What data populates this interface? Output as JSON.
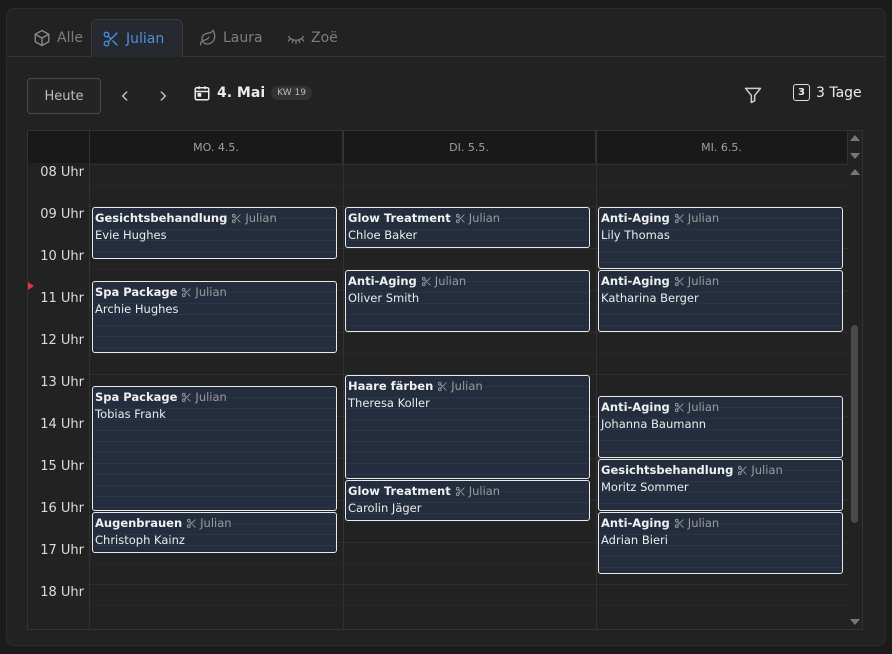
{
  "tabs": [
    {
      "label": "Alle",
      "icon": "cube-icon"
    },
    {
      "label": "Julian",
      "icon": "scissors-icon"
    },
    {
      "label": "Laura",
      "icon": "leaf-icon"
    },
    {
      "label": "Zoë",
      "icon": "eyelash-icon"
    }
  ],
  "active_tab": "Julian",
  "accent_color": "#4b8fe0",
  "toolbar": {
    "today_label": "Heute",
    "date_label": "4. Mai",
    "week_badge": "KW 19",
    "view_count": "3",
    "view_label": "3 Tage"
  },
  "calendar": {
    "days": [
      "MO. 4.5.",
      "DI. 5.5.",
      "MI. 6.5."
    ],
    "hours": [
      "08 Uhr",
      "09 Uhr",
      "10 Uhr",
      "11 Uhr",
      "12 Uhr",
      "13 Uhr",
      "14 Uhr",
      "15 Uhr",
      "16 Uhr",
      "17 Uhr",
      "18 Uhr"
    ],
    "events": [
      {
        "day": 0,
        "start": "09:00",
        "end": "10:15",
        "service": "Gesichtsbehandlung",
        "staff": "Julian",
        "client": "Evie Hughes"
      },
      {
        "day": 0,
        "start": "10:45",
        "end": "12:30",
        "service": "Spa Package",
        "staff": "Julian",
        "client": "Archie Hughes"
      },
      {
        "day": 0,
        "start": "13:15",
        "end": "16:15",
        "service": "Spa Package",
        "staff": "Julian",
        "client": "Tobias Frank"
      },
      {
        "day": 0,
        "start": "16:15",
        "end": "17:15",
        "service": "Augenbrauen",
        "staff": "Julian",
        "client": "Christoph Kainz"
      },
      {
        "day": 1,
        "start": "09:00",
        "end": "10:00",
        "service": "Glow Treatment",
        "staff": "Julian",
        "client": "Chloe Baker"
      },
      {
        "day": 1,
        "start": "10:30",
        "end": "12:00",
        "service": "Anti-Aging",
        "staff": "Julian",
        "client": "Oliver Smith"
      },
      {
        "day": 1,
        "start": "13:00",
        "end": "15:30",
        "service": "Haare färben",
        "staff": "Julian",
        "client": "Theresa Koller"
      },
      {
        "day": 1,
        "start": "15:30",
        "end": "16:30",
        "service": "Glow Treatment",
        "staff": "Julian",
        "client": "Carolin Jäger"
      },
      {
        "day": 2,
        "start": "09:00",
        "end": "10:30",
        "service": "Anti-Aging",
        "staff": "Julian",
        "client": "Lily Thomas"
      },
      {
        "day": 2,
        "start": "10:30",
        "end": "12:00",
        "service": "Anti-Aging",
        "staff": "Julian",
        "client": "Katharina Berger"
      },
      {
        "day": 2,
        "start": "13:30",
        "end": "15:00",
        "service": "Anti-Aging",
        "staff": "Julian",
        "client": "Johanna Baumann"
      },
      {
        "day": 2,
        "start": "15:00",
        "end": "16:15",
        "service": "Gesichtsbehandlung",
        "staff": "Julian",
        "client": "Moritz Sommer"
      },
      {
        "day": 2,
        "start": "16:15",
        "end": "17:45",
        "service": "Anti-Aging",
        "staff": "Julian",
        "client": "Adrian Bieri"
      }
    ]
  }
}
